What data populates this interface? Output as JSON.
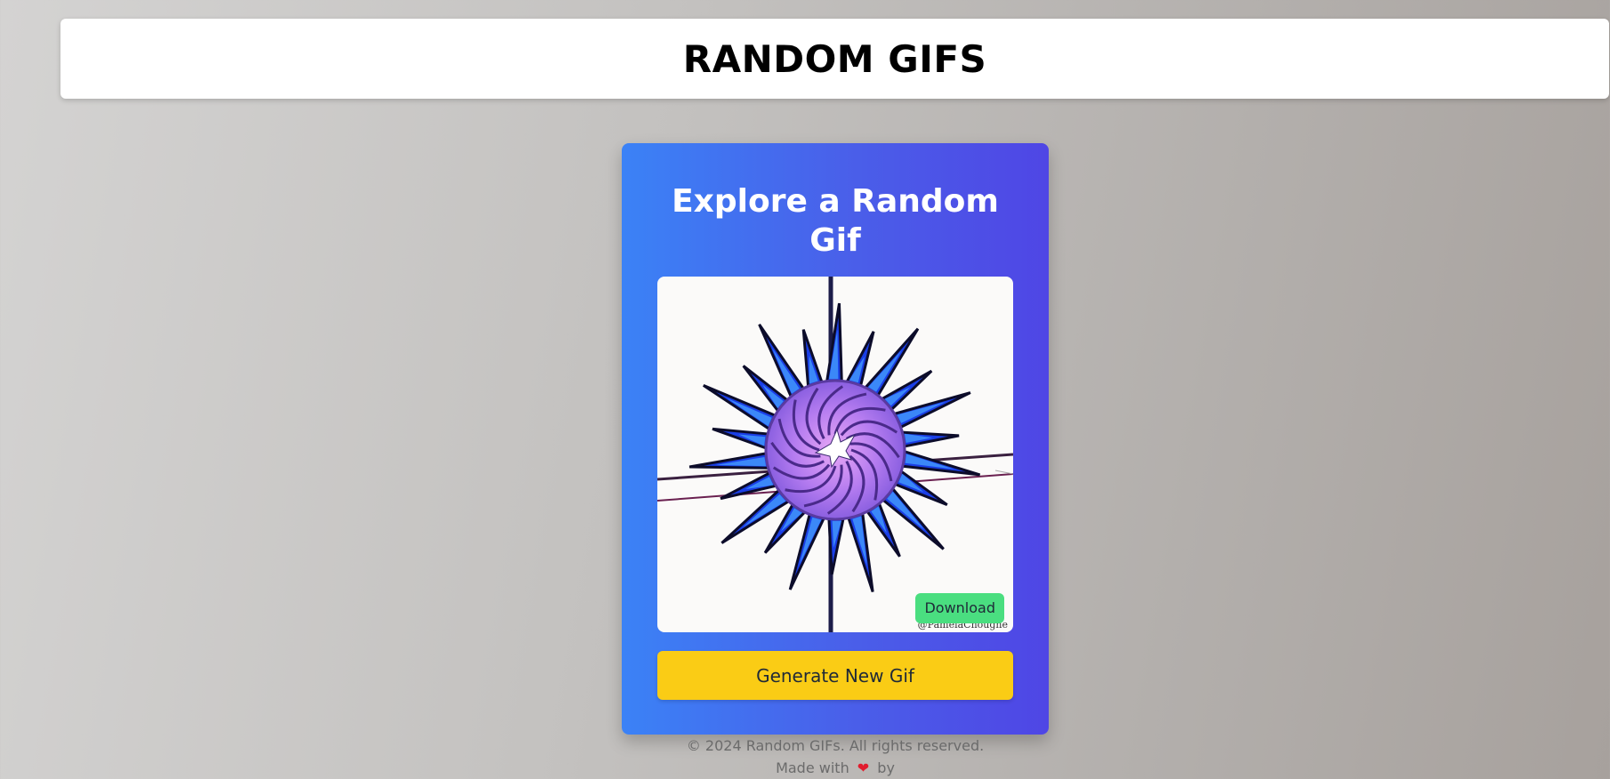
{
  "header": {
    "title": "RANDOM GIFS"
  },
  "card": {
    "title": "Explore a Random Gif",
    "gif": {
      "icon": "abstract-star-bird-gif",
      "watermark": "@PamelaChoughe"
    },
    "download_label": "Download",
    "generate_label": "Generate New Gif"
  },
  "footer": {
    "copyright": "© 2024 Random GIFs. All rights reserved.",
    "made_with": "Made with",
    "heart_icon": "heart-icon",
    "heart": "❤",
    "by": "by"
  },
  "colors": {
    "card_gradient_start": "#3b82f6",
    "card_gradient_end": "#4f46e5",
    "download_button": "#4ade80",
    "generate_button": "#facc15",
    "heart": "#e11d2e"
  }
}
